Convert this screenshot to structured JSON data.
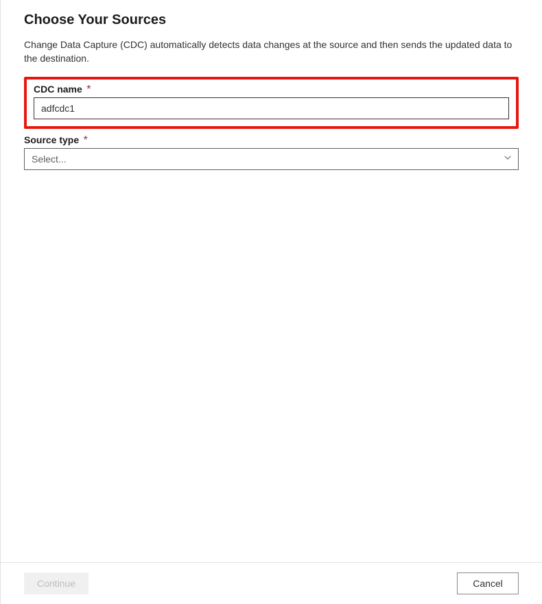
{
  "header": {
    "title": "Choose Your Sources",
    "description": "Change Data Capture (CDC) automatically detects data changes at the source and then sends the updated data to the destination."
  },
  "form": {
    "cdc_name": {
      "label": "CDC name",
      "required_mark": "*",
      "value": "adfcdc1"
    },
    "source_type": {
      "label": "Source type",
      "required_mark": "*",
      "placeholder": "Select..."
    }
  },
  "footer": {
    "continue_label": "Continue",
    "cancel_label": "Cancel"
  }
}
